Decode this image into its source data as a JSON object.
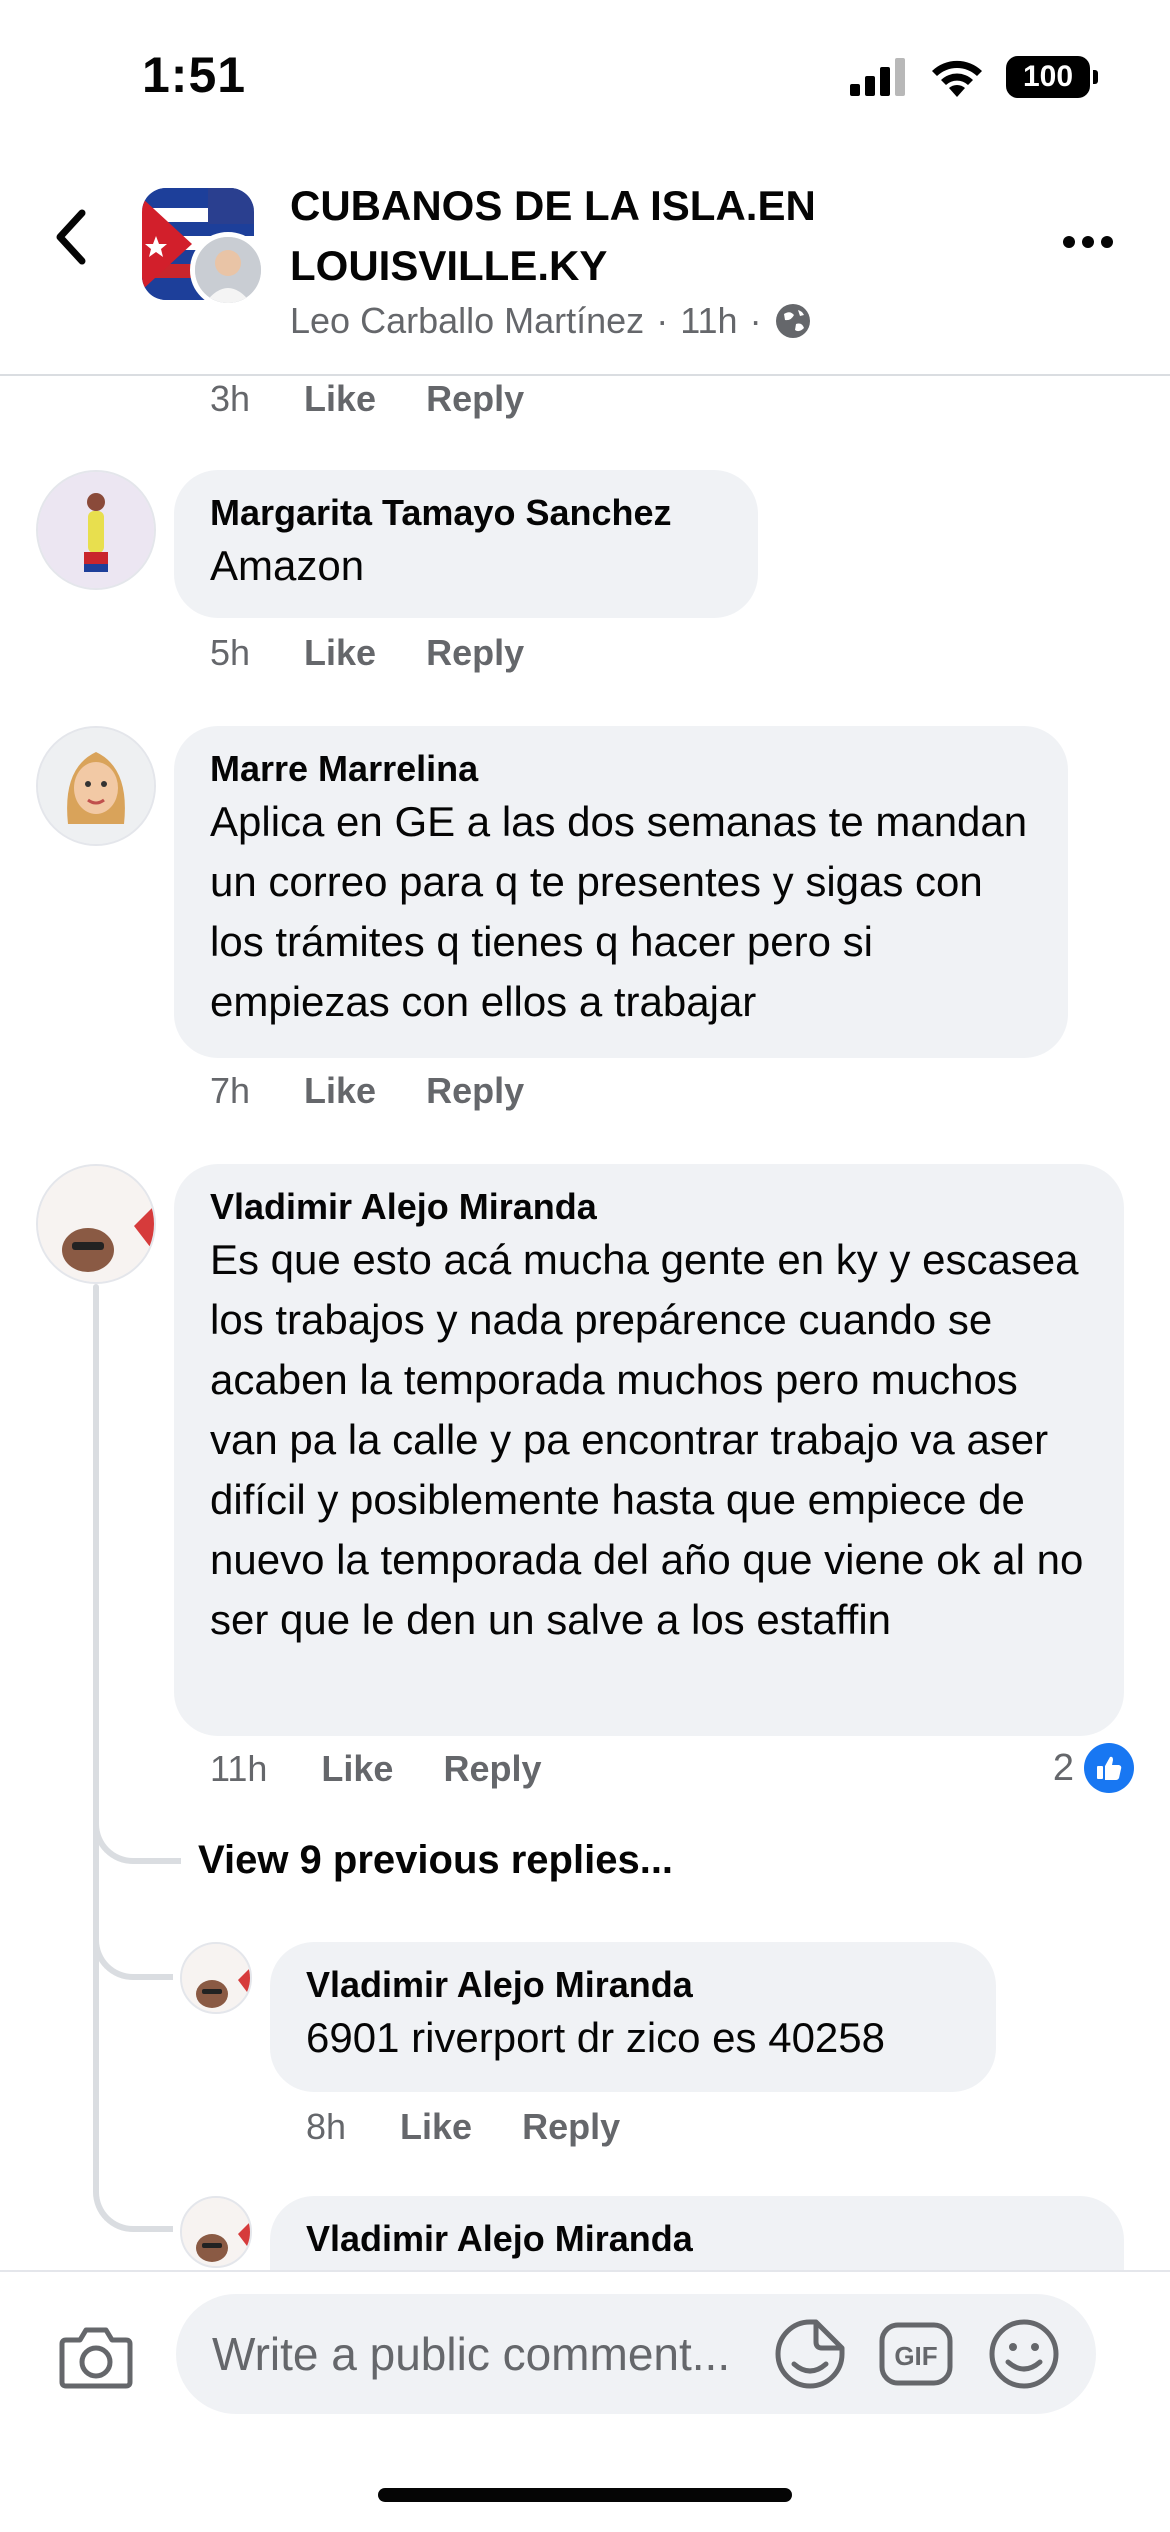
{
  "status_bar": {
    "time": "1:51",
    "battery": "100"
  },
  "header": {
    "title": "CUBANOS DE LA ISLA.EN LOUISVILLE.KY",
    "author": "Leo Carballo Martínez",
    "separator": "·",
    "time": "11h",
    "separator2": "·",
    "privacy_icon": "globe-icon"
  },
  "top_actions": {
    "time": "3h",
    "like": "Like",
    "reply": "Reply"
  },
  "comments": [
    {
      "name": "Margarita Tamayo Sanchez",
      "text": "Amazon",
      "time": "5h",
      "like": "Like",
      "reply": "Reply"
    },
    {
      "name": "Marre Marrelina",
      "text": "Aplica en GE  a las dos semanas te mandan un correo para q te presentes y sigas con los trámites q tienes q hacer pero si empiezas con ellos a trabajar",
      "time": "7h",
      "like": "Like",
      "reply": "Reply"
    },
    {
      "name": "Vladimir Alejo Miranda",
      "text": "Es que esto acá mucha gente en ky y escasea los trabajos y nada prepárence cuando se acaben la temporada muchos pero muchos van pa la calle y pa encontrar trabajo va aser difícil y posiblemente hasta que empiece de nuevo la temporada del año que viene ok al no ser que le den un salve a los estaffin",
      "time": "11h",
      "like": "Like",
      "reply": "Reply",
      "reaction_count": "2",
      "reaction_icon": "like-icon"
    }
  ],
  "view_previous": "View 9 previous replies...",
  "replies": [
    {
      "name": "Vladimir Alejo Miranda",
      "text": "6901 riverport dr zico es 40258",
      "time": "8h",
      "like": "Like",
      "reply": "Reply"
    },
    {
      "name": "Vladimir Alejo Miranda"
    }
  ],
  "composer": {
    "placeholder": "Write a public comment...",
    "gif_label": "GIF",
    "icons": [
      "camera-icon",
      "sticker-icon",
      "gif-icon",
      "emoji-icon"
    ]
  }
}
